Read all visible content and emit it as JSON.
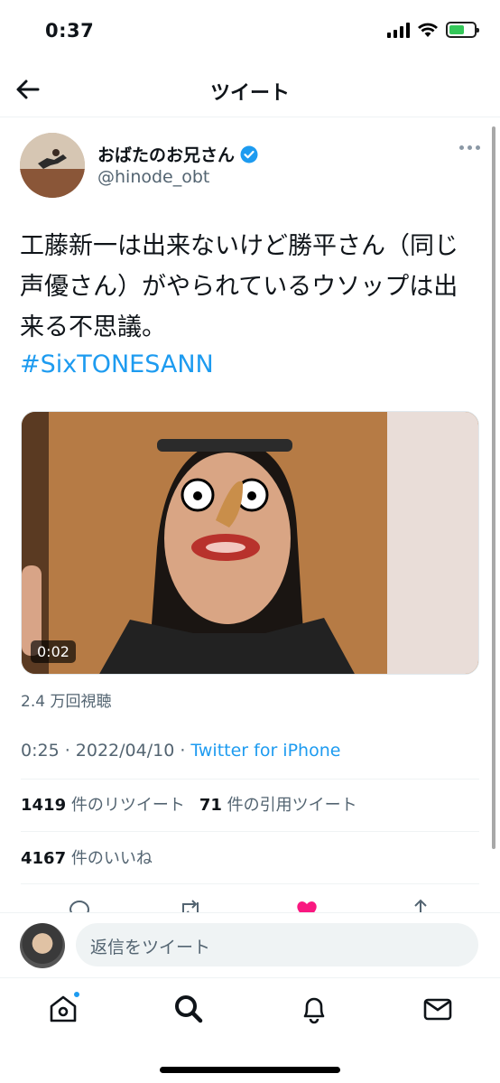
{
  "status_bar": {
    "time": "0:37"
  },
  "header": {
    "title": "ツイート"
  },
  "author": {
    "name": "おばたのお兄さん",
    "handle": "@hinode_obt",
    "verified": true
  },
  "tweet": {
    "text": "工藤新一は出来ないけど勝平さん（同じ声優さん）がやられているウソップは出来る不思議。",
    "hashtag": "#SixTONESANN",
    "video_duration": "0:02",
    "views": "2.4 万回視聴",
    "timestamp": "0:25 · 2022/04/10",
    "source_sep": " · ",
    "source": "Twitter for iPhone"
  },
  "stats": {
    "retweets_count": "1419",
    "retweets_label": "件のリツイート",
    "quotes_count": "71",
    "quotes_label": "件の引用ツイート",
    "likes_count": "4167",
    "likes_label": "件のいいね"
  },
  "reply": {
    "placeholder": "返信をツイート"
  },
  "colors": {
    "accent": "#1d9bf0",
    "like": "#f91880",
    "text": "#0f1419",
    "muted": "#536471"
  },
  "icons": {
    "back": "arrow-left-icon",
    "verified": "verified-badge-icon",
    "more": "more-horizontal-icon",
    "tabs": [
      "home-icon",
      "search-icon",
      "bell-icon",
      "mail-icon"
    ]
  }
}
